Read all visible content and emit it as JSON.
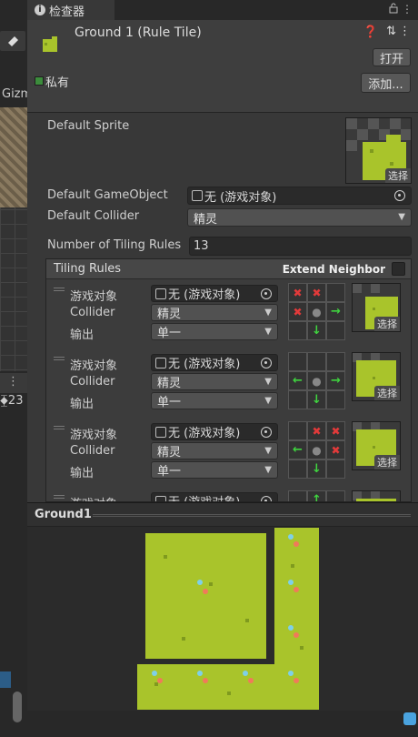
{
  "left_strip": {
    "gizmo_label": "Gizm",
    "count": "⧱23"
  },
  "inspector": {
    "tab_label": "检查器",
    "asset_title": "Ground 1 (Rule Tile)",
    "open_button": "打开",
    "add_button": "添加...",
    "private_label": "私有",
    "default_sprite_label": "Default Sprite",
    "choose_label": "选择",
    "default_gameobject_label": "Default GameObject",
    "default_gameobject_value": "无 (游戏对象)",
    "default_collider_label": "Default Collider",
    "default_collider_value": "精灵",
    "num_tiling_rules_label": "Number of Tiling Rules",
    "num_tiling_rules_value": "13",
    "tiling_rules_title": "Tiling Rules",
    "extend_neighbor_label": "Extend Neighbor",
    "rules": [
      {
        "gameobject_label": "游戏对象",
        "gameobject_value": "无 (游戏对象)",
        "collider_label": "Collider",
        "collider_value": "精灵",
        "output_label": "输出",
        "output_value": "单一",
        "grid": [
          "x",
          "x",
          "",
          "x",
          "o",
          "→",
          "",
          "↓",
          ""
        ]
      },
      {
        "gameobject_label": "游戏对象",
        "gameobject_value": "无 (游戏对象)",
        "collider_label": "Collider",
        "collider_value": "精灵",
        "output_label": "输出",
        "output_value": "单一",
        "grid": [
          "",
          "",
          "",
          "←",
          "o",
          "→",
          "",
          "↓",
          ""
        ]
      },
      {
        "gameobject_label": "游戏对象",
        "gameobject_value": "无 (游戏对象)",
        "collider_label": "Collider",
        "collider_value": "精灵",
        "output_label": "输出",
        "output_value": "单一",
        "grid": [
          "",
          "x",
          "x",
          "←",
          "o",
          "x",
          "",
          "↓",
          ""
        ]
      },
      {
        "gameobject_label": "游戏对象",
        "gameobject_value": "无 (游戏对象)",
        "grid": [
          "",
          "↑",
          "",
          "",
          "",
          "",
          "",
          "",
          ""
        ]
      }
    ]
  },
  "preview": {
    "title": "Ground1"
  },
  "colors": {
    "grass": "#a9c42b",
    "grass_dark": "#7f9a1e",
    "red_x": "#e23a3a",
    "green_arrow": "#3fd33f"
  }
}
